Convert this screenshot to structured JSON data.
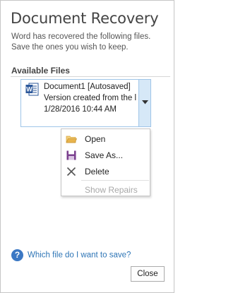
{
  "pane": {
    "title": "Document Recovery",
    "description_line1": "Word has recovered the following files.",
    "description_line2": "Save the ones you wish to keep.",
    "section_label": "Available Files"
  },
  "file": {
    "name": "Document1  [Autosaved]",
    "line2": "Version created from the l",
    "date": "1/28/2016 10:44 AM",
    "icon": "word-doc-icon"
  },
  "menu": {
    "items": [
      {
        "label": "Open",
        "icon": "folder-open-icon",
        "enabled": true
      },
      {
        "label": "Save As...",
        "icon": "save-icon",
        "enabled": true
      },
      {
        "label": "Delete",
        "icon": "delete-x-icon",
        "enabled": true
      },
      {
        "label": "Show Repairs",
        "icon": "",
        "enabled": false
      }
    ]
  },
  "footer": {
    "help_text": "Which file do I want to save?",
    "help_icon": "?",
    "close_label": "Close"
  },
  "colors": {
    "accent": "#2e75b6",
    "selection_border": "#9fc5e8",
    "dropdown_bg": "#d6e8f7",
    "word_blue": "#2b579a",
    "folder": "#e8b44c",
    "save": "#7a3f8e"
  }
}
